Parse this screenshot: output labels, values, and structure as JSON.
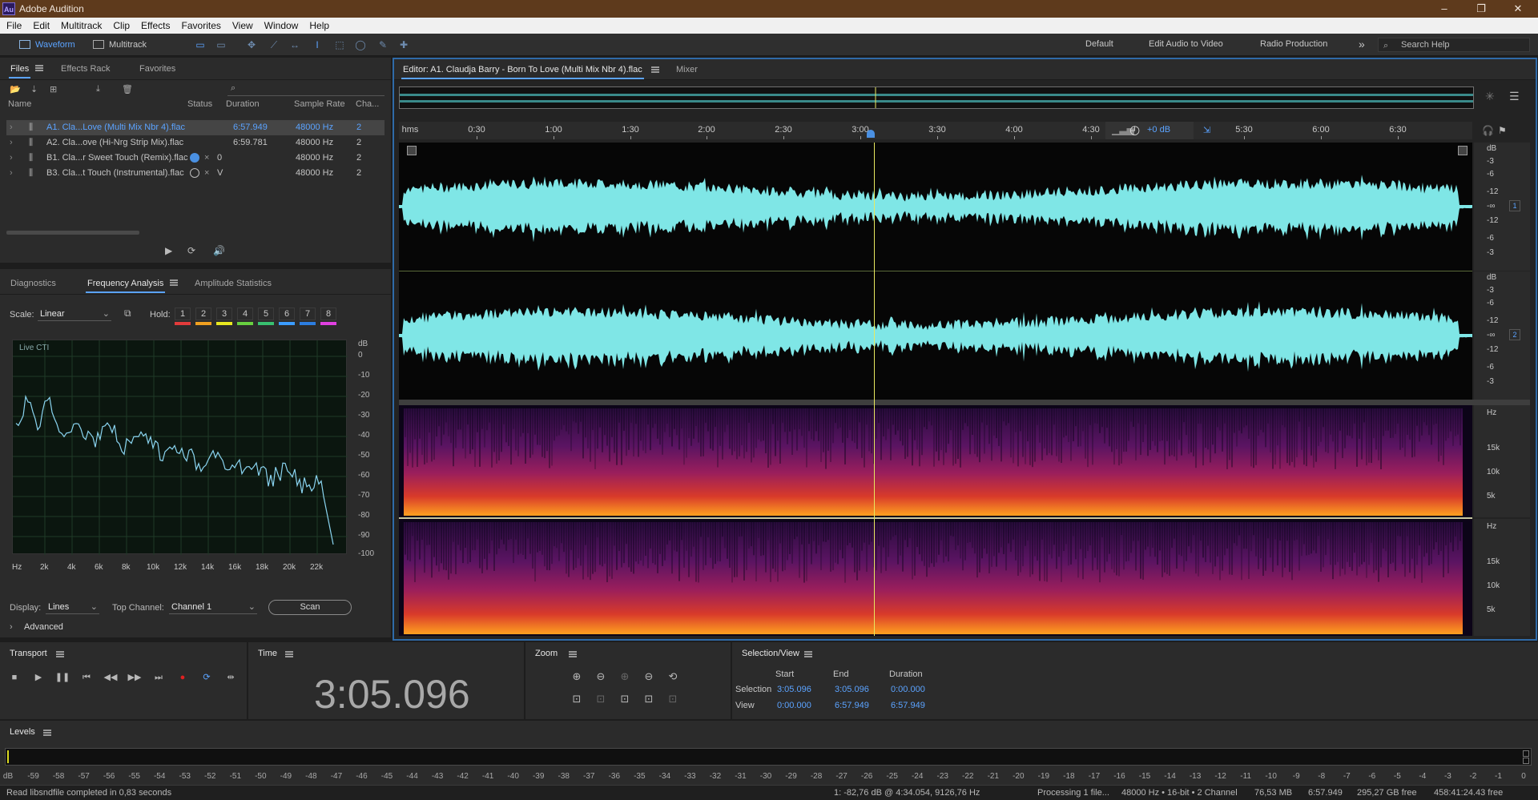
{
  "app": {
    "title": "Adobe Audition",
    "logo": "Au"
  },
  "window_controls": {
    "minimize": "–",
    "restore": "❐",
    "close": "✕"
  },
  "menu": [
    "File",
    "Edit",
    "Multitrack",
    "Clip",
    "Effects",
    "Favorites",
    "View",
    "Window",
    "Help"
  ],
  "toolbar": {
    "waveform_label": "Waveform",
    "multitrack_label": "Multitrack",
    "workspaces": [
      "Default",
      "Edit Audio to Video",
      "Radio Production"
    ],
    "more": "»",
    "search_placeholder": "Search Help"
  },
  "files_panel": {
    "tabs": [
      "Files",
      "Effects Rack",
      "Favorites"
    ],
    "columns": {
      "name": "Name",
      "status": "Status",
      "duration": "Duration",
      "sample_rate": "Sample Rate",
      "channels": "Cha..."
    },
    "rows": [
      {
        "name": "A1. Cla...Love (Multi Mix Nbr 4).flac",
        "status": "",
        "duration": "6:57.949",
        "sample_rate": "48000 Hz",
        "channels": "2",
        "selected": true
      },
      {
        "name": "A2. Cla...ove (Hi-Nrg Strip Mix).flac",
        "status": "",
        "duration": "6:59.781",
        "sample_rate": "48000 Hz",
        "channels": "2",
        "selected": false
      },
      {
        "name": "B1. Cla...r Sweet Touch (Remix).flac",
        "status": "0",
        "duration": "",
        "sample_rate": "48000 Hz",
        "channels": "2",
        "selected": false
      },
      {
        "name": "B3. Cla...t Touch (Instrumental).flac",
        "status": "V",
        "duration": "",
        "sample_rate": "48000 Hz",
        "channels": "2",
        "selected": false
      }
    ]
  },
  "analysis_panel": {
    "tabs": [
      "Diagnostics",
      "Frequency Analysis",
      "Amplitude Statistics"
    ],
    "scale_label": "Scale:",
    "scale_value": "Linear",
    "hold_label": "Hold:",
    "hold_buttons": [
      "1",
      "2",
      "3",
      "4",
      "5",
      "6",
      "7",
      "8"
    ],
    "hold_colors": [
      "#e23b3b",
      "#f0a020",
      "#e8e820",
      "#68d040",
      "#38c070",
      "#3b9cff",
      "#2c7de0",
      "#e040e0"
    ],
    "graph_label": "Live CTI",
    "db_unit": "dB",
    "db_ticks": [
      "0",
      "-10",
      "-20",
      "-30",
      "-40",
      "-50",
      "-60",
      "-70",
      "-80",
      "-90",
      "-100"
    ],
    "hz_ticks": [
      "Hz",
      "2k",
      "4k",
      "6k",
      "8k",
      "10k",
      "12k",
      "14k",
      "16k",
      "18k",
      "20k",
      "22k"
    ],
    "display_label": "Display:",
    "display_value": "Lines",
    "top_channel_label": "Top Channel:",
    "top_channel_value": "Channel 1",
    "scan_label": "Scan",
    "advanced_label": "Advanced"
  },
  "editor": {
    "tab_label": "Editor: A1. Claudja Barry - Born To Love (Multi Mix Nbr 4).flac",
    "mixer_label": "Mixer",
    "ruler_unit": "hms",
    "ruler_ticks": [
      "0:30",
      "1:00",
      "1:30",
      "2:00",
      "2:30",
      "3:00",
      "3:30",
      "4:00",
      "4:30",
      "5:30",
      "6:00",
      "6:30"
    ],
    "gain_label": "+0 dB",
    "db_labels_ch": [
      "dB",
      "-3",
      "-6",
      "-12",
      "-∞",
      "-12",
      "-6",
      "-3"
    ],
    "channel_numbers": [
      "1",
      "2"
    ],
    "hz_labels": [
      "Hz",
      "15k",
      "10k",
      "5k"
    ],
    "waveform_color": "#7fe6e6",
    "playhead_color": "#e8e860"
  },
  "transport": {
    "title": "Transport",
    "buttons": [
      "stop",
      "play",
      "pause",
      "go-to-start",
      "rewind",
      "fast-forward",
      "go-to-end",
      "record",
      "loop",
      "skip-selection"
    ]
  },
  "time_panel": {
    "title": "Time",
    "value": "3:05.096"
  },
  "zoom_panel": {
    "title": "Zoom"
  },
  "selection_view": {
    "title": "Selection/View",
    "col_start": "Start",
    "col_end": "End",
    "col_duration": "Duration",
    "selection_label": "Selection",
    "selection_start": "3:05.096",
    "selection_end": "3:05.096",
    "selection_duration": "0:00.000",
    "view_label": "View",
    "view_start": "0:00.000",
    "view_end": "6:57.949",
    "view_duration": "6:57.949"
  },
  "levels": {
    "title": "Levels",
    "scale": [
      "dB",
      "-59",
      "-58",
      "-57",
      "-56",
      "-55",
      "-54",
      "-53",
      "-52",
      "-51",
      "-50",
      "-49",
      "-48",
      "-47",
      "-46",
      "-45",
      "-44",
      "-43",
      "-42",
      "-41",
      "-40",
      "-39",
      "-38",
      "-37",
      "-36",
      "-35",
      "-34",
      "-33",
      "-32",
      "-31",
      "-30",
      "-29",
      "-28",
      "-27",
      "-26",
      "-25",
      "-24",
      "-23",
      "-22",
      "-21",
      "-20",
      "-19",
      "-18",
      "-17",
      "-16",
      "-15",
      "-14",
      "-13",
      "-12",
      "-11",
      "-10",
      "-9",
      "-8",
      "-7",
      "-6",
      "-5",
      "-4",
      "-3",
      "-2",
      "-1",
      "0"
    ]
  },
  "status": {
    "left": "Read libsndfile completed in 0,83 seconds",
    "cursor": "1: -82,76 dB @ 4:34.054, 9126,76 Hz",
    "processing": "Processing 1 file...",
    "format": "48000 Hz • 16-bit • 2 Channel",
    "size": "76,53 MB",
    "duration": "6:57.949",
    "free": "295,27 GB free",
    "free_time": "458:41:24.43 free"
  }
}
